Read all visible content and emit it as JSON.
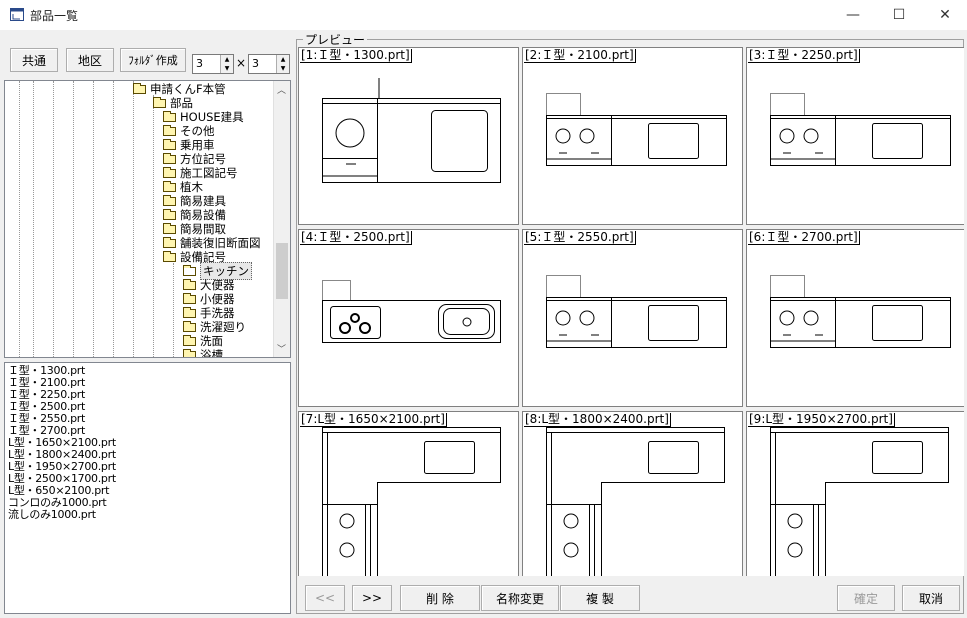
{
  "window": {
    "title": "部品一覧",
    "minimize_glyph": "—",
    "maximize_glyph": "☐",
    "close_glyph": "✕"
  },
  "toolbar": {
    "common_label": "共通",
    "region_label": "地区",
    "create_folder_label": "ﾌｫﾙﾀﾞ作成",
    "cols_value": "3",
    "times_label": "×",
    "rows_value": "3"
  },
  "tree": {
    "items": [
      {
        "label": "申請くんF本管",
        "open": false
      },
      {
        "label": "部品",
        "open": false
      },
      {
        "label": "HOUSE建具",
        "open": false
      },
      {
        "label": "その他",
        "open": false
      },
      {
        "label": "乗用車",
        "open": false
      },
      {
        "label": "方位記号",
        "open": false
      },
      {
        "label": "施工図記号",
        "open": false
      },
      {
        "label": "植木",
        "open": false
      },
      {
        "label": "簡易建具",
        "open": false
      },
      {
        "label": "簡易設備",
        "open": false
      },
      {
        "label": "簡易間取",
        "open": false
      },
      {
        "label": "舗装復旧断面図",
        "open": false
      },
      {
        "label": "設備記号",
        "open": false
      },
      {
        "label": "キッチン",
        "open": true,
        "selected": true
      },
      {
        "label": "大便器",
        "open": false
      },
      {
        "label": "小便器",
        "open": false
      },
      {
        "label": "手洗器",
        "open": false
      },
      {
        "label": "洗濯廻り",
        "open": false
      },
      {
        "label": "洗面",
        "open": false
      },
      {
        "label": "浴槽",
        "open": false
      }
    ]
  },
  "file_list": [
    "Ｉ型・1300.prt",
    "Ｉ型・2100.prt",
    "Ｉ型・2250.prt",
    "Ｉ型・2500.prt",
    "Ｉ型・2550.prt",
    "Ｉ型・2700.prt",
    "L型・1650×2100.prt",
    "L型・1800×2400.prt",
    "L型・1950×2700.prt",
    "L型・2500×1700.prt",
    "L型・650×2100.prt",
    "コンロのみ1000.prt",
    "流しのみ1000.prt"
  ],
  "preview": {
    "label": "プレビュー",
    "cells": [
      {
        "title": "[1:Ｉ型・1300.prt]",
        "kind": "i1300"
      },
      {
        "title": "[2:Ｉ型・2100.prt]",
        "kind": "i"
      },
      {
        "title": "[3:Ｉ型・2250.prt]",
        "kind": "i"
      },
      {
        "title": "[4:Ｉ型・2500.prt]",
        "kind": "i2500"
      },
      {
        "title": "[5:Ｉ型・2550.prt]",
        "kind": "i"
      },
      {
        "title": "[6:Ｉ型・2700.prt]",
        "kind": "i"
      },
      {
        "title": "[7:L型・1650×2100.prt]",
        "kind": "l"
      },
      {
        "title": "[8:L型・1800×2400.prt]",
        "kind": "l"
      },
      {
        "title": "[9:L型・1950×2700.prt]",
        "kind": "l"
      }
    ]
  },
  "buttons": {
    "prev_label": "<<",
    "next_label": ">>",
    "delete_label": "削 除",
    "rename_label": "名称変更",
    "duplicate_label": "複 製",
    "confirm_label": "確定",
    "cancel_label": "取消"
  }
}
